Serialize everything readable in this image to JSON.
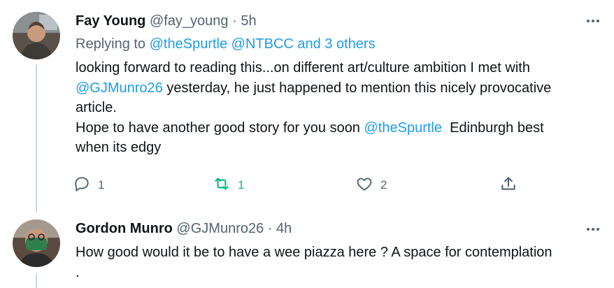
{
  "tweets": [
    {
      "author_name": "Fay Young",
      "handle": "@fay_young",
      "separator": "·",
      "time": "5h",
      "replying_prefix": "Replying to",
      "replying_to": "@theSpurtle @NTBCC and 3 others",
      "body": {
        "line1": "looking forward to reading this...on different art/culture ambition I met with",
        "mention1": "@GJMunro26",
        "line2_rest": " yesterday, he just happened to mention this nicely provocative",
        "line3": "article.",
        "line4_start": "Hope to have another good story for you soon ",
        "mention2": "@theSpurtle",
        "line4_rest": "  Edinburgh best",
        "line5": "when its edgy"
      },
      "stats": {
        "replies": "1",
        "retweets": "1",
        "likes": "2"
      }
    },
    {
      "author_name": "Gordon Munro",
      "handle": "@GJMunro26",
      "separator": "·",
      "time": "4h",
      "body": {
        "line1": "How good would it be to have a wee piazza here ? A space for contemplation",
        "line2": "."
      }
    }
  ],
  "colors": {
    "link": "#1d9bf0",
    "retweet_active": "#00ba7c",
    "muted": "#536471",
    "text": "#0f1419"
  },
  "icons": [
    "more-icon",
    "reply-icon",
    "retweet-icon",
    "like-icon",
    "share-icon"
  ]
}
